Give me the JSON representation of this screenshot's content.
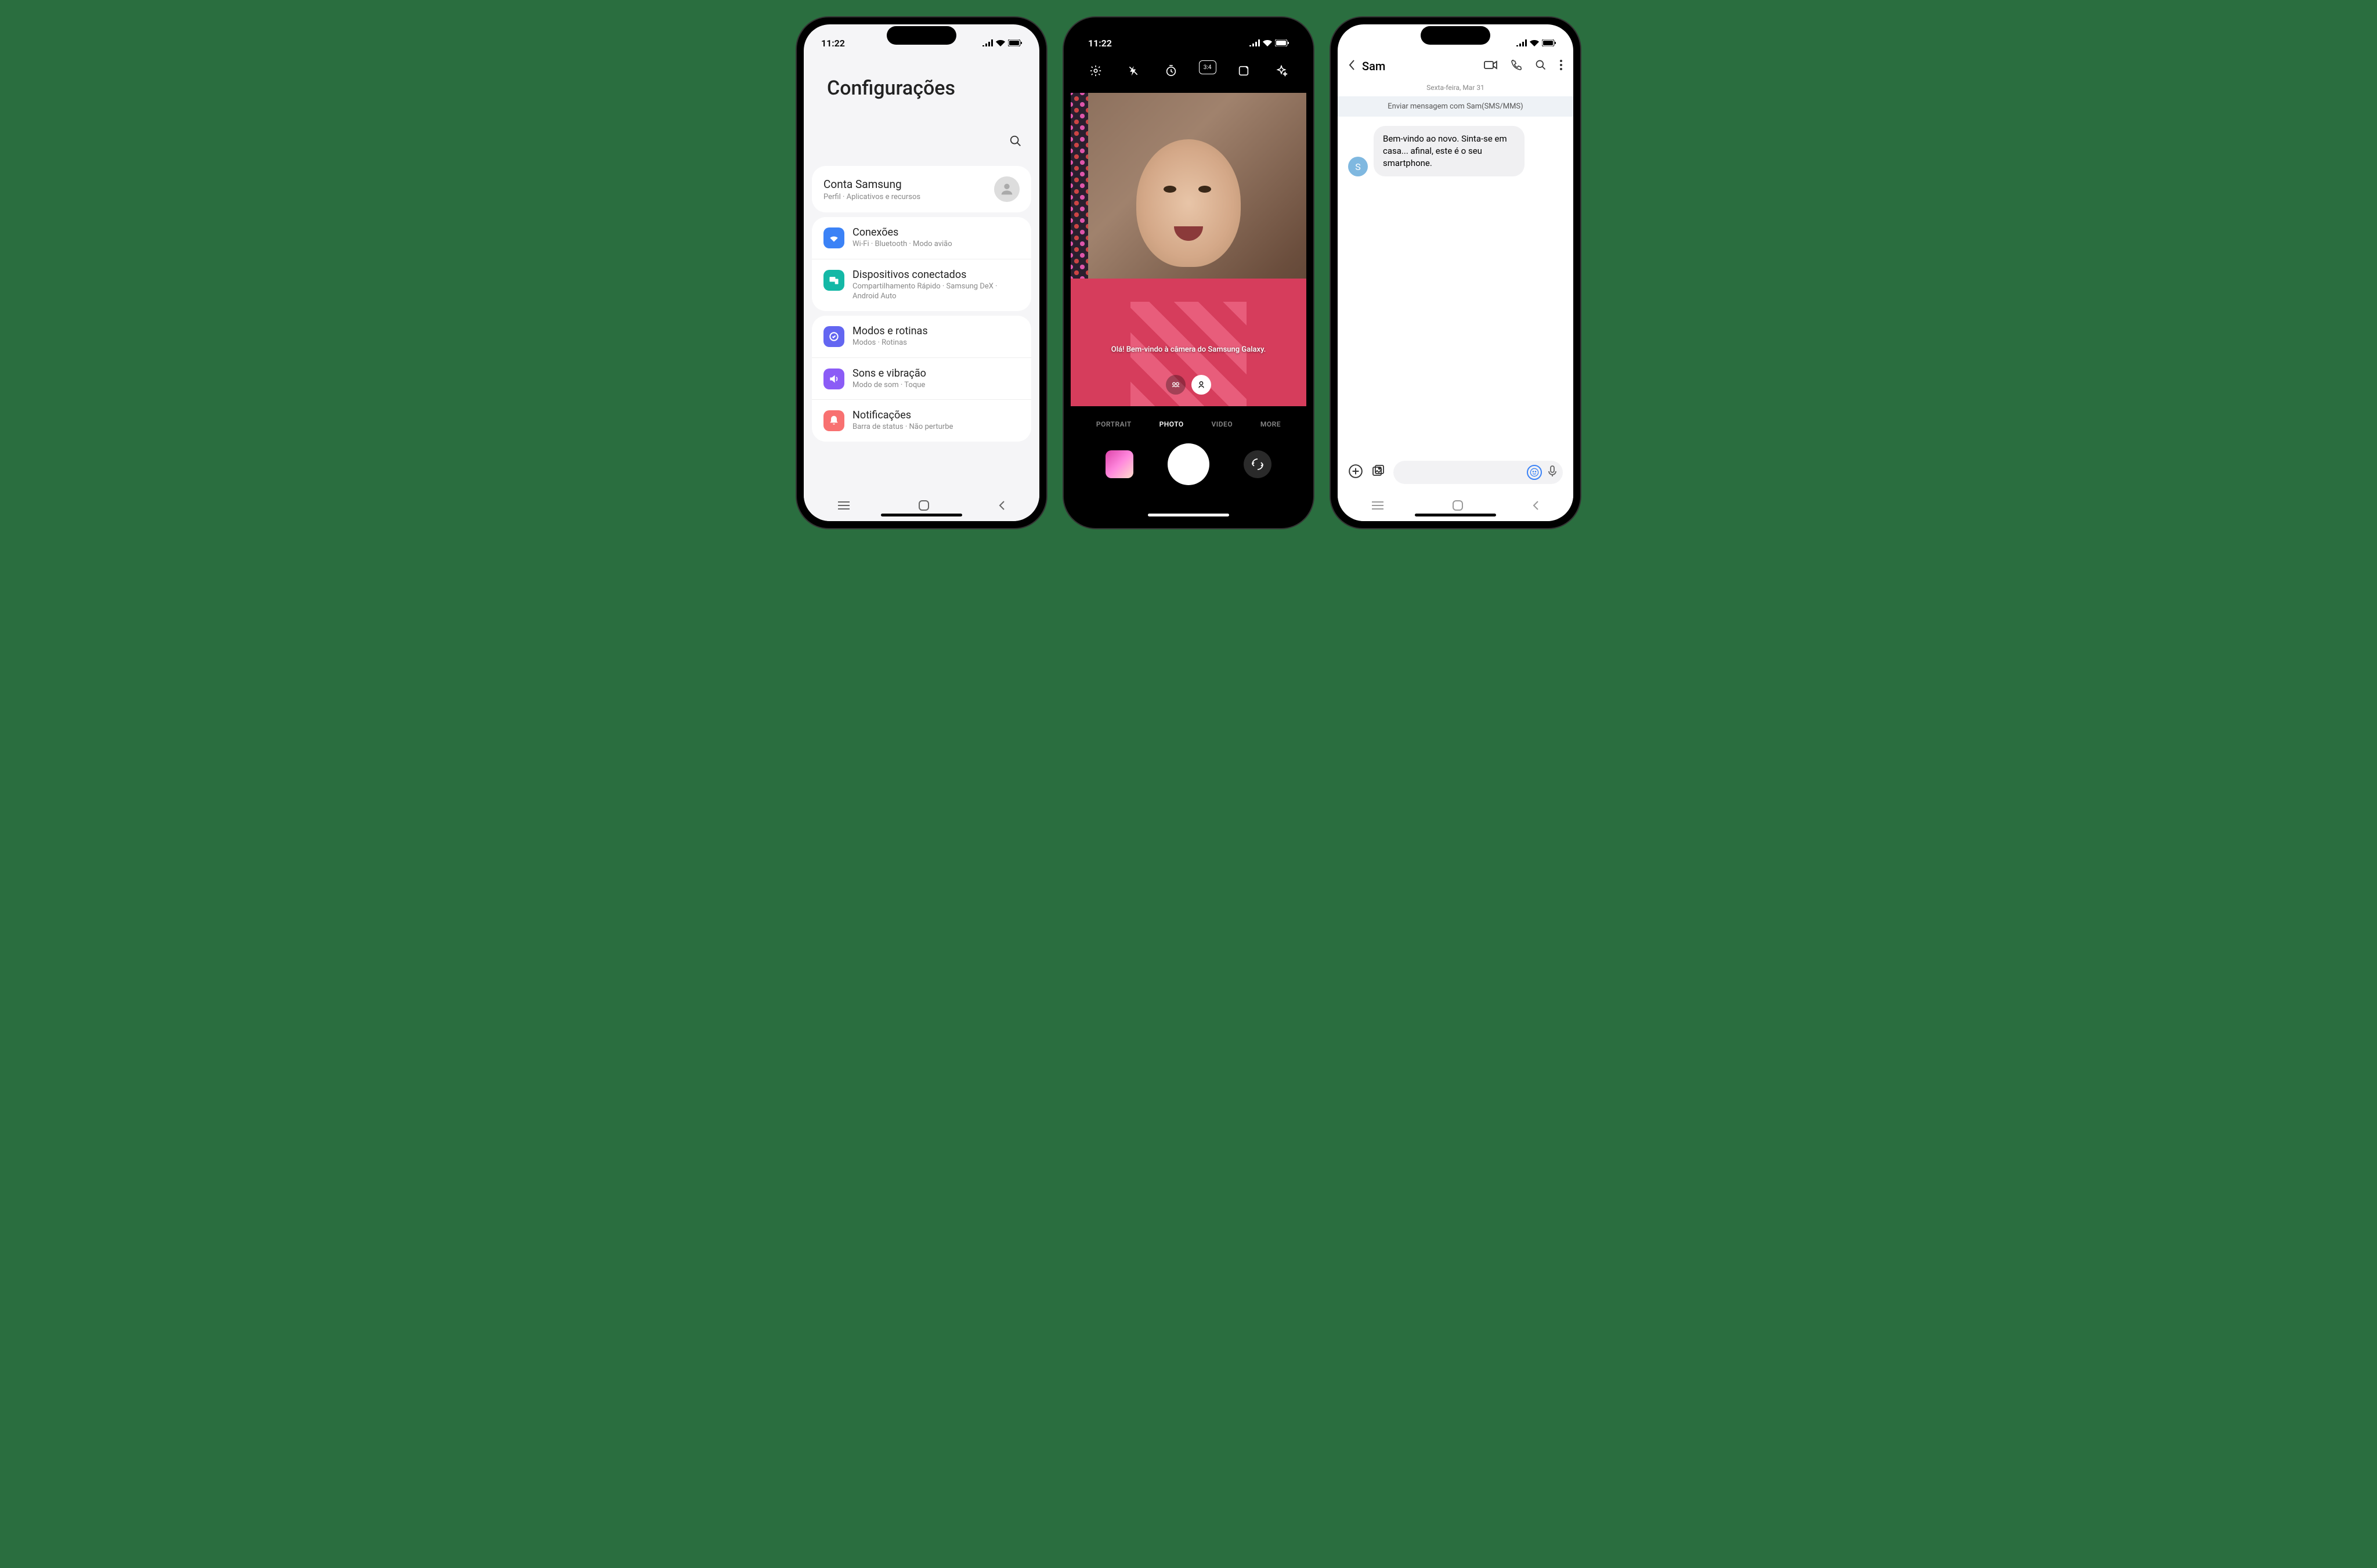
{
  "phone1": {
    "status": {
      "time": "11:22"
    },
    "title": "Configurações",
    "account": {
      "title": "Conta Samsung",
      "subtitle": "Perfil · Aplicativos e recursos"
    },
    "groups": [
      {
        "items": [
          {
            "icon": "wifi",
            "color": "#3b82f6",
            "title": "Conexões",
            "subtitle": "Wi-Fi · Bluetooth · Modo avião"
          },
          {
            "icon": "devices",
            "color": "#14b8a6",
            "title": "Dispositivos conectados",
            "subtitle": "Compartilhamento Rápido · Samsung DeX · Android Auto"
          }
        ]
      },
      {
        "items": [
          {
            "icon": "routines",
            "color": "#6366f1",
            "title": "Modos e rotinas",
            "subtitle": "Modos · Rotinas"
          },
          {
            "icon": "sound",
            "color": "#8b5cf6",
            "title": "Sons e vibração",
            "subtitle": "Modo de som · Toque"
          },
          {
            "icon": "notif",
            "color": "#f87171",
            "title": "Notificações",
            "subtitle": "Barra de status · Não perturbe"
          }
        ]
      }
    ]
  },
  "phone2": {
    "status": {
      "time": "11:22"
    },
    "viewfinder_caption": "Olá! Bem-vindo à câmera do Samsung Galaxy.",
    "aspect_label": "3:4",
    "modes": [
      "PORTRAIT",
      "PHOTO",
      "VIDEO",
      "MORE"
    ],
    "active_mode": "PHOTO"
  },
  "phone3": {
    "header": {
      "name": "Sam"
    },
    "date": "Sexta-feira, Mar 31",
    "banner": "Enviar mensagem com Sam(SMS/MMS)",
    "message": {
      "avatar_initial": "S",
      "text": "Bem-vindo ao novo. Sinta-se em casa... afinal, este é o seu smartphone."
    }
  }
}
